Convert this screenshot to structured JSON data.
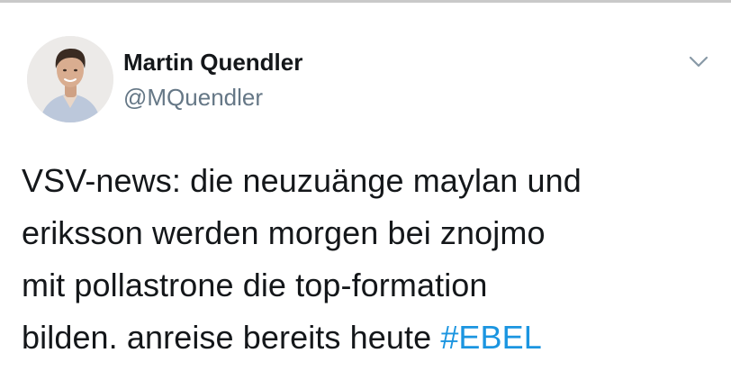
{
  "tweet": {
    "author": {
      "display_name": "Martin Quendler",
      "handle": "@MQuendler"
    },
    "text_lines": [
      "VSV-news: die neuzuänge maylan und",
      "eriksson werden morgen bei znojmo",
      "mit pollastrone die top-formation",
      "bilden. anreise bereits heute "
    ],
    "hashtag": "#EBEL"
  },
  "icons": {
    "avatar": "profile-photo",
    "menu": "chevron-down-icon"
  },
  "colors": {
    "text": "#14171a",
    "secondary_text": "#657786",
    "link": "#1b95e0",
    "top_rule": "#c9c9c9"
  }
}
